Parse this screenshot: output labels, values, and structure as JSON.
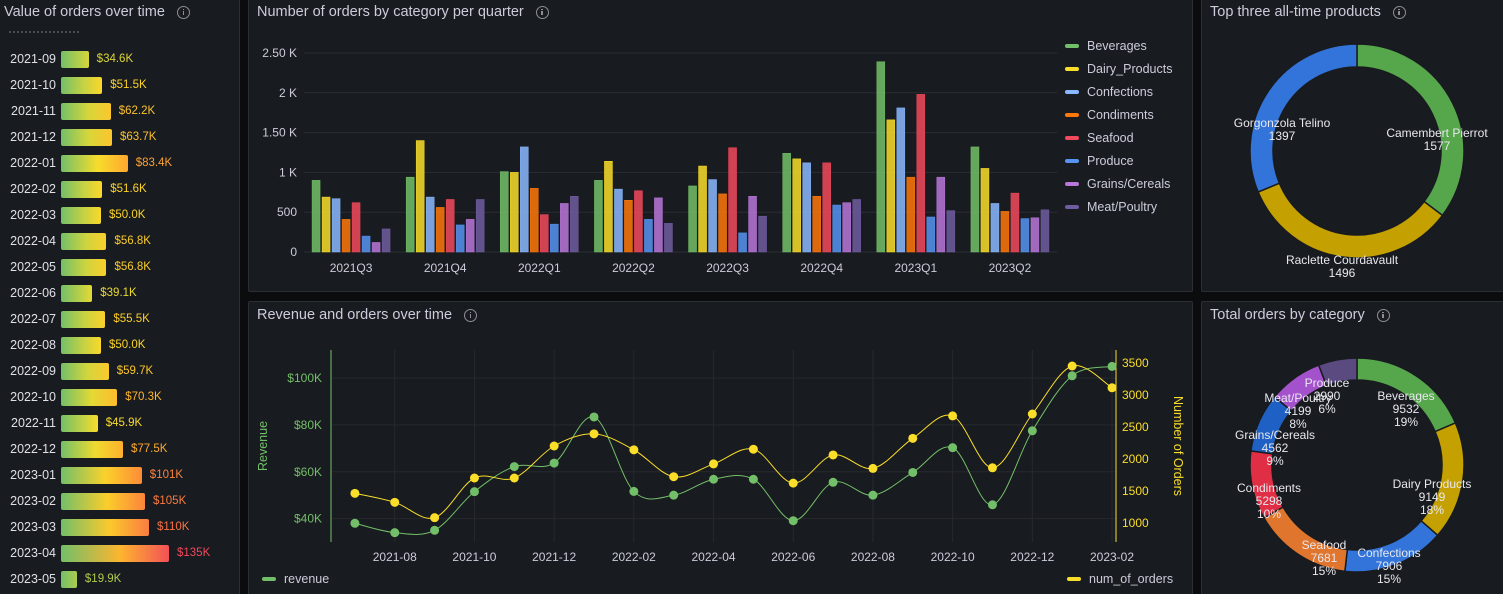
{
  "panels": {
    "value_orders": {
      "title": "Value of orders over time"
    },
    "orders_category_quarter": {
      "title": "Number of orders by category per quarter"
    },
    "top_products": {
      "title": "Top three all-time products"
    },
    "revenue_orders": {
      "title": "Revenue and orders over time"
    },
    "total_orders_category": {
      "title": "Total orders by category"
    }
  },
  "colors": {
    "Beverages": "#73bf69",
    "Dairy_Products": "#fade2a",
    "Confections": "#8ab8ff",
    "Condiments": "#ff780a",
    "Seafood": "#f2495c",
    "Produce": "#5794f2",
    "Grains/Cereals": "#b877d9",
    "Meat/Poultry": "#705da0",
    "revenue": "#73bf69",
    "num_of_orders": "#fade2a"
  },
  "chart_data": [
    {
      "type": "bar",
      "panel": "value_orders",
      "orientation": "horizontal",
      "categories": [
        "2021-09",
        "2021-10",
        "2021-11",
        "2021-12",
        "2022-01",
        "2022-02",
        "2022-03",
        "2022-04",
        "2022-05",
        "2022-06",
        "2022-07",
        "2022-08",
        "2022-09",
        "2022-10",
        "2022-11",
        "2022-12",
        "2023-01",
        "2023-02",
        "2023-03",
        "2023-04",
        "2023-05"
      ],
      "values": [
        34.6,
        51.5,
        62.2,
        63.7,
        83.4,
        51.6,
        50.0,
        56.8,
        56.8,
        39.1,
        55.5,
        50.0,
        59.7,
        70.3,
        45.9,
        77.5,
        101,
        105,
        110,
        135,
        19.9
      ],
      "labels": [
        "$34.6K",
        "$51.5K",
        "$62.2K",
        "$63.7K",
        "$83.4K",
        "$51.6K",
        "$50.0K",
        "$56.8K",
        "$56.8K",
        "$39.1K",
        "$55.5K",
        "$50.0K",
        "$59.7K",
        "$70.3K",
        "$45.9K",
        "$77.5K",
        "$101K",
        "$105K",
        "$110K",
        "$135K",
        "$19.9K"
      ],
      "unit": "$K"
    },
    {
      "type": "bar",
      "panel": "orders_category_quarter",
      "categories": [
        "2021Q3",
        "2021Q4",
        "2022Q1",
        "2022Q2",
        "2022Q3",
        "2022Q4",
        "2023Q1",
        "2023Q2"
      ],
      "ylim": [
        0,
        2550
      ],
      "yticks": [
        "0",
        "500",
        "1 K",
        "1.50 K",
        "2 K",
        "2.50 K"
      ],
      "ytick_values": [
        0,
        500,
        1000,
        1500,
        2000,
        2500
      ],
      "series": [
        {
          "name": "Beverages",
          "values": [
            900,
            940,
            1010,
            900,
            830,
            1240,
            2390,
            1320
          ]
        },
        {
          "name": "Dairy_Products",
          "values": [
            690,
            1400,
            1000,
            1140,
            1080,
            1170,
            1660,
            1050
          ]
        },
        {
          "name": "Confections",
          "values": [
            670,
            690,
            1320,
            790,
            910,
            1120,
            1810,
            610
          ]
        },
        {
          "name": "Condiments",
          "values": [
            410,
            560,
            800,
            650,
            730,
            700,
            940,
            510
          ]
        },
        {
          "name": "Seafood",
          "values": [
            620,
            660,
            470,
            770,
            1310,
            1120,
            1980,
            740
          ]
        },
        {
          "name": "Produce",
          "values": [
            200,
            340,
            350,
            410,
            240,
            590,
            440,
            420
          ]
        },
        {
          "name": "Grains/Cereals",
          "values": [
            120,
            410,
            610,
            680,
            700,
            620,
            940,
            430
          ]
        },
        {
          "name": "Meat/Poultry",
          "values": [
            290,
            660,
            700,
            360,
            450,
            660,
            520,
            530
          ]
        }
      ],
      "legend_position": "right"
    },
    {
      "type": "pie",
      "panel": "top_products",
      "donut": true,
      "categories": [
        "Camembert Pierrot",
        "Raclette Courdavault",
        "Gorgonzola Telino"
      ],
      "values": [
        1577,
        1496,
        1397
      ],
      "slice_colors": [
        "#56a64b",
        "#c4a000",
        "#3274d9"
      ]
    },
    {
      "type": "line",
      "panel": "revenue_orders",
      "x": [
        "2021-07",
        "2021-08",
        "2021-09",
        "2021-10",
        "2021-11",
        "2021-12",
        "2022-01",
        "2022-02",
        "2022-03",
        "2022-04",
        "2022-05",
        "2022-06",
        "2022-07",
        "2022-08",
        "2022-09",
        "2022-10",
        "2022-11",
        "2022-12",
        "2023-01",
        "2023-02"
      ],
      "xticks": [
        "2021-08",
        "2021-10",
        "2021-12",
        "2022-02",
        "2022-04",
        "2022-06",
        "2022-08",
        "2022-10",
        "2022-12",
        "2023-02"
      ],
      "series": [
        {
          "name": "revenue",
          "axis": "left",
          "values": [
            38000,
            34000,
            35000,
            51500,
            62200,
            63700,
            83400,
            51600,
            50000,
            56800,
            56800,
            39100,
            55500,
            50000,
            59700,
            70300,
            45900,
            77500,
            101000,
            105000
          ]
        },
        {
          "name": "num_of_orders",
          "axis": "right",
          "values": [
            1460,
            1320,
            1080,
            1700,
            1700,
            2200,
            2390,
            2140,
            1720,
            1920,
            2150,
            1620,
            2060,
            1850,
            2320,
            2670,
            1860,
            2700,
            3450,
            3110
          ]
        }
      ],
      "ylabel": "Revenue",
      "y2label": "Number of Orders",
      "ylim": [
        30000,
        112000
      ],
      "y2lim": [
        700,
        3700
      ],
      "yticks": [
        "$40K",
        "$60K",
        "$80K",
        "$100K"
      ],
      "ytick_values": [
        40000,
        60000,
        80000,
        100000
      ],
      "y2ticks": [
        "1000",
        "1500",
        "2000",
        "2500",
        "3000",
        "3500"
      ],
      "y2tick_values": [
        1000,
        1500,
        2000,
        2500,
        3000,
        3500
      ],
      "legend": [
        "revenue",
        "num_of_orders"
      ],
      "grid": true
    },
    {
      "type": "pie",
      "panel": "total_orders_category",
      "donut": true,
      "categories": [
        "Beverages",
        "Dairy Products",
        "Confections",
        "Seafood",
        "Condiments",
        "Grains/Cereals",
        "Meat/Poultry",
        "Produce"
      ],
      "values": [
        9532,
        9149,
        7906,
        7681,
        5298,
        4562,
        4199,
        2990
      ],
      "value_labels": [
        "9532",
        "9149",
        "7906",
        "7681",
        "5298",
        "4562",
        "4199",
        "2990"
      ],
      "percent_labels": [
        "19%",
        "18%",
        "15%",
        "15%",
        "10%",
        "9%",
        "8%",
        "6%"
      ],
      "slice_colors": [
        "#56a64b",
        "#c4a000",
        "#3274d9",
        "#e0752d",
        "#e02f44",
        "#1f60c4",
        "#a352cc",
        "#5a4a80"
      ]
    }
  ]
}
